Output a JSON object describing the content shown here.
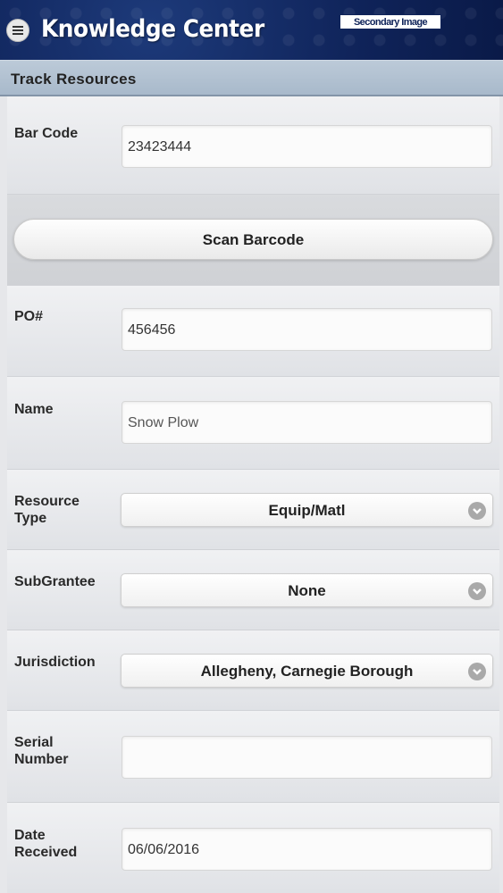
{
  "header": {
    "app_title": "Knowledge Center",
    "secondary_image_text": "Secondary Image",
    "menu_icon": "hamburger-menu-icon"
  },
  "subheader": {
    "title": "Track Resources"
  },
  "form": {
    "bar_code": {
      "label": "Bar Code",
      "value": "23423444"
    },
    "scan_button": {
      "label": "Scan Barcode"
    },
    "po": {
      "label": "PO#",
      "value": "456456"
    },
    "name": {
      "label": "Name",
      "value": "Snow Plow"
    },
    "resource_type": {
      "label_line1": "Resource",
      "label_line2": "Type",
      "selected": "Equip/Matl"
    },
    "subgrantee": {
      "label": "SubGrantee",
      "selected": "None"
    },
    "jurisdiction": {
      "label": "Jurisdiction",
      "selected": "Allegheny, Carnegie Borough"
    },
    "serial_number": {
      "label_line1": "Serial",
      "label_line2": "Number",
      "value": ""
    },
    "date_received": {
      "label_line1": "Date",
      "label_line2": "Received",
      "value": "06/06/2016"
    }
  },
  "colors": {
    "header_bg": "#0f2359",
    "subheader_bg": "#b2c1d2",
    "page_bg": "#e6e7ea"
  }
}
